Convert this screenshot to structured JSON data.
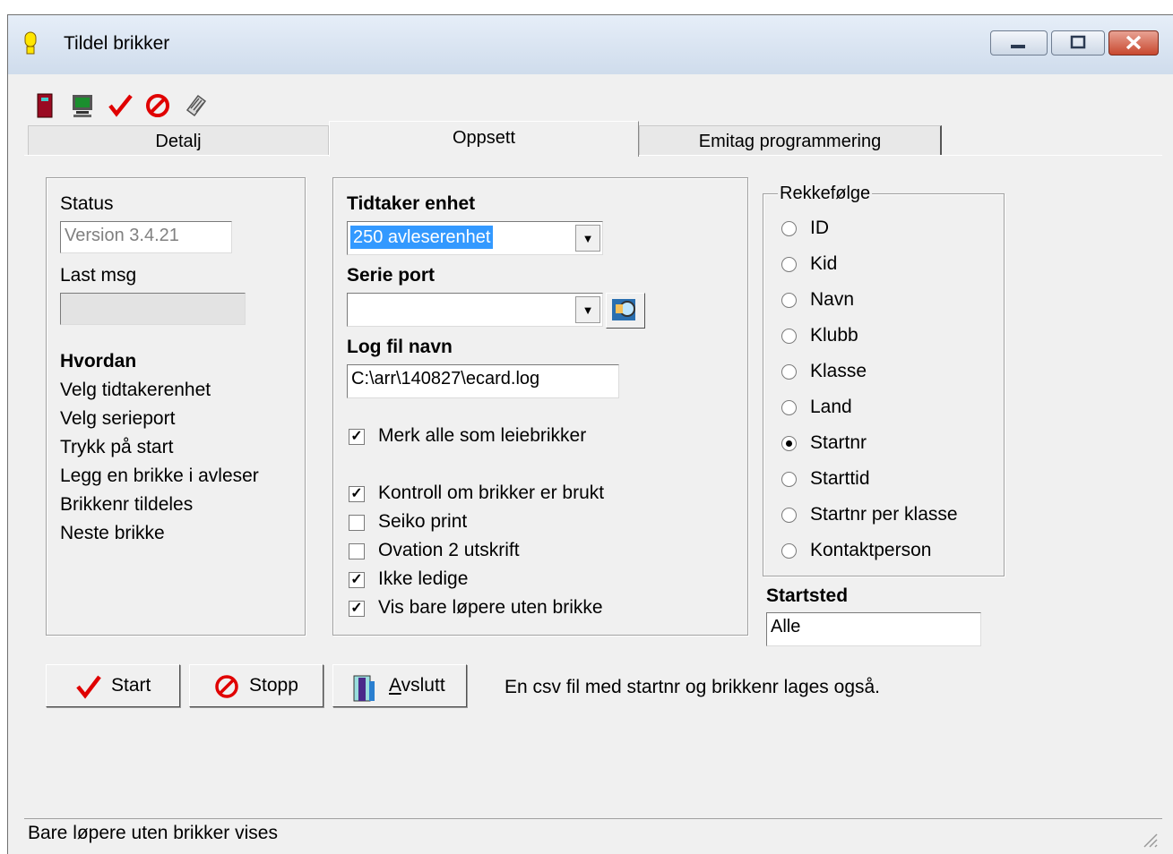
{
  "window": {
    "title": "Tildel brikker"
  },
  "toolbar": {
    "icons": [
      "door-exit-icon",
      "monitor-icon",
      "checkmark-icon",
      "stop-icon",
      "ecard-icon"
    ]
  },
  "tabs": [
    {
      "label": "Detalj"
    },
    {
      "label": "Oppsett"
    },
    {
      "label": "Emitag programmering"
    }
  ],
  "status_group": {
    "status_label": "Status",
    "status_value": "Version 3.4.21",
    "last_msg_label": "Last msg",
    "last_msg_value": "",
    "howto_title": "Hvordan",
    "howto_steps": [
      "Velg tidtakerenhet",
      "Velg serieport",
      "Trykk på start",
      "Legg en brikke i avleser",
      "Brikkenr tildeles",
      "Neste brikke"
    ]
  },
  "setup": {
    "unit_label": "Tidtaker enhet",
    "unit_value": "250 avleserenhet",
    "port_label": "Serie port",
    "port_value": "",
    "log_label": "Log fil navn",
    "log_value": "C:\\arr\\140827\\ecard.log",
    "checkboxes": [
      {
        "label": "Merk alle som leiebrikker",
        "checked": true
      },
      {
        "label": "Kontroll om brikker er brukt",
        "checked": true
      },
      {
        "label": "Seiko print",
        "checked": false
      },
      {
        "label": "Ovation 2 utskrift",
        "checked": false
      },
      {
        "label": "Ikke ledige",
        "checked": true
      },
      {
        "label": "Vis bare løpere uten brikke",
        "checked": true
      }
    ]
  },
  "order": {
    "title": "Rekkefølge",
    "options": [
      "ID",
      "Kid",
      "Navn",
      "Klubb",
      "Klasse",
      "Land",
      "Startnr",
      "Starttid",
      "Startnr per klasse",
      "Kontaktperson"
    ],
    "selected": "Startnr"
  },
  "start_place": {
    "label": "Startsted",
    "value": "Alle"
  },
  "buttons": {
    "start": "Start",
    "stop": "Stopp",
    "exit_prefix": "A",
    "exit_rest": "vslutt"
  },
  "info_text": "En csv fil med startnr og brikkenr lages også.",
  "statusbar": {
    "text": "Bare løpere uten brikker vises"
  },
  "colors": {
    "selection": "#3399ff",
    "check_red": "#e00000",
    "window_bg": "#f0f0f0"
  }
}
